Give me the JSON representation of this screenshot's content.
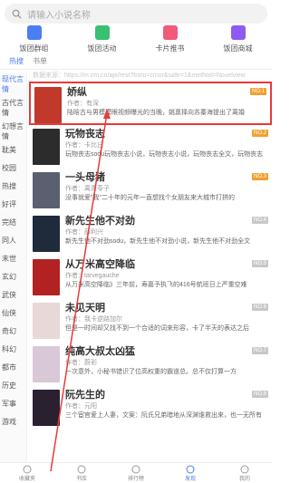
{
  "search": {
    "placeholder": "请输入小说名称"
  },
  "topnav": [
    {
      "label": "饭团群组",
      "icon": "group-icon",
      "color": "#4a7ef2"
    },
    {
      "label": "饭团活动",
      "icon": "activity-icon",
      "color": "#38c172"
    },
    {
      "label": "卡片推书",
      "icon": "card-icon",
      "color": "#f25a7a"
    },
    {
      "label": "饭团商城",
      "icon": "shop-icon",
      "color": "#8e5af2"
    }
  ],
  "tabs": [
    {
      "label": "热搜",
      "active": true
    },
    {
      "label": "书单",
      "active": false
    }
  ],
  "sidebar": [
    "现代言情",
    "古代言情",
    "幻想言情",
    "耽美",
    "校园",
    "热搜",
    "好评",
    "完结",
    "同人",
    "末世",
    "玄幻",
    "武侠",
    "仙侠",
    "奇幻",
    "科幻",
    "都市",
    "历史",
    "军事",
    "游戏"
  ],
  "url_text": "数据来源：https://m.cm.cn/api/rest?from=cmor&safe=1&method=Novelview",
  "books": [
    {
      "title": "娇纵",
      "author": "作者：有深",
      "desc": "陆晗古与男模模眼视频曝光的当晚，姚禀择向苏蓁海提出了离婚",
      "rank": "NO.1",
      "cover": "#c0392b"
    },
    {
      "title": "玩物丧志",
      "author": "作者：卡比丘",
      "desc": "玩物丧志sodu玩物丧志小说，玩物丧志小说，玩物丧志全文，玩物丧志",
      "rank": "NO.2",
      "cover": "#2c2c2c"
    },
    {
      "title": "一头母猪",
      "author": "作者：离青苓子",
      "desc": "没事就爱\"我\"二十年的元年一直想找个女朋友来大城市打拼的",
      "rank": "NO.3",
      "cover": "#5a6070"
    },
    {
      "title": "新先生他不对劲",
      "author": "作者：薛利兴",
      "desc": "新先生他不对劲sodu，新先生他不对劲小说，新先生他不对劲全文",
      "rank": "NO.4",
      "cover": "#1f2a3a"
    },
    {
      "title": "从万米高空降临",
      "author": "作者：tarvegauche",
      "desc": "从万米高空降临》三年前，寿嘉予执飞的416号航班日上严重空难",
      "rank": "NO.5",
      "cover": "#b22222"
    },
    {
      "title": "未见天明",
      "author": "作者：我卡逆路加尔",
      "desc": "但是一时间却又找不到一个合适的词来形容，卡了半天的表达之后",
      "rank": "NO.6",
      "cover": "#e8d8d8"
    },
    {
      "title": "纯高大叔太凶猛",
      "author": "作者：蔚彩",
      "desc": "一次意外，小秘书错识了位高权重的霸道总。总不仅打算一方",
      "rank": "NO.7",
      "cover": "#d8c8d8"
    },
    {
      "title": "阮先生的",
      "author": "作者：元阳",
      "desc": "三个宦官爱上人妻，文案：阮氏兄弟暗地从深渊谁救出来，也一无所有",
      "rank": "NO.8",
      "cover": "#2a2030"
    }
  ],
  "bottom_nav": [
    {
      "label": "收藏夹",
      "icon": "bookmark-icon",
      "active": false
    },
    {
      "label": "书库",
      "icon": "library-icon",
      "active": false
    },
    {
      "label": "排行榜",
      "icon": "ranking-icon",
      "active": false
    },
    {
      "label": "发现",
      "icon": "discover-icon",
      "active": true
    },
    {
      "label": "我的",
      "icon": "profile-icon",
      "active": false
    }
  ]
}
